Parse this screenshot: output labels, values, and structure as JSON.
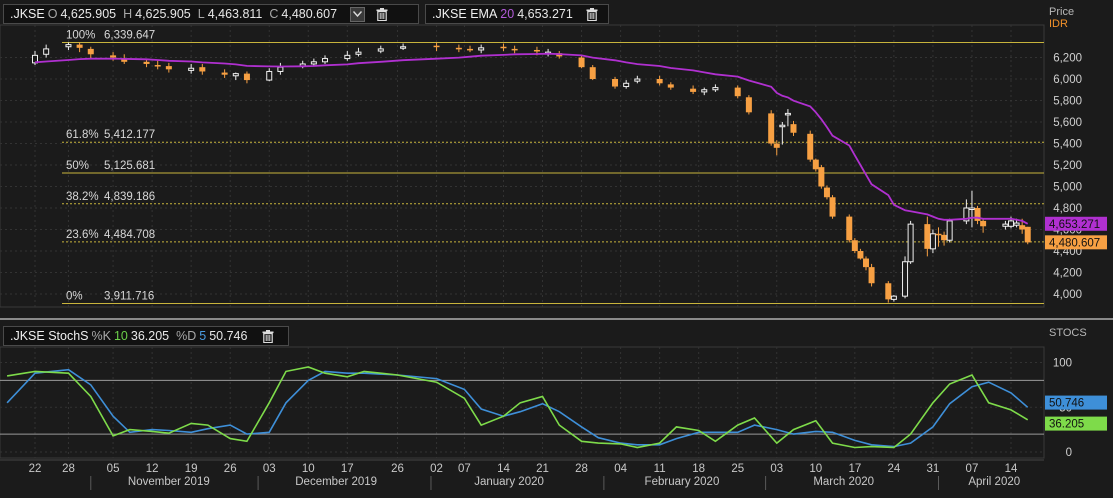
{
  "price_header": {
    "ticker": ".JKSE",
    "open_label": "O",
    "open": "4,625.905",
    "high_label": "H",
    "high": "4,625.905",
    "low_label": "L",
    "low": "4,463.811",
    "close_label": "C",
    "close": "4,480.607"
  },
  "ema_header": {
    "name": ".JKSE EMA",
    "period": "20",
    "value": "4,653.271"
  },
  "stoch_header": {
    "name": ".JKSE StochS",
    "k_label": "%K",
    "k_period": "10",
    "k_value": "36.205",
    "d_label": "%D",
    "d_period": "5",
    "d_value": "50.746"
  },
  "price_scale": {
    "title": "Price",
    "currency": "IDR",
    "ticks": [
      "6,200",
      "6,000",
      "5,800",
      "5,600",
      "5,400",
      "5,200",
      "5,000",
      "4,800",
      "4,600",
      "4,400",
      "4,200",
      "4,000"
    ]
  },
  "stoch_scale": {
    "title": "STOCS",
    "ticks": [
      "100",
      "50",
      "0"
    ]
  },
  "badges": {
    "ema": "4,653.271",
    "close": "4,480.607",
    "d": "50.746",
    "k": "36.205"
  },
  "colors": {
    "up": "#f0f0f0",
    "down": "#f7a043",
    "ema": "#b030d0",
    "k_line": "#7edb4a",
    "d_line": "#3e8fd8",
    "fib": "#c8b43c",
    "background": "#1b1b1b"
  },
  "fib_levels": [
    {
      "pct": "100%",
      "value": "6,339.647",
      "price": 6339.647,
      "style": "solid"
    },
    {
      "pct": "61.8%",
      "value": "5,412.177",
      "price": 5412.177,
      "style": "dashed"
    },
    {
      "pct": "50%",
      "value": "5,125.681",
      "price": 5125.681,
      "style": "solid"
    },
    {
      "pct": "38.2%",
      "value": "4,839.186",
      "price": 4839.186,
      "style": "dashed"
    },
    {
      "pct": "23.6%",
      "value": "4,484.708",
      "price": 4484.708,
      "style": "dashed"
    },
    {
      "pct": "0%",
      "value": "3,911.716",
      "price": 3911.716,
      "style": "solid"
    }
  ],
  "x_axis": {
    "day_ticks": [
      "22",
      "28",
      "05",
      "12",
      "19",
      "26",
      "03",
      "10",
      "17",
      "26",
      "02",
      "07",
      "14",
      "21",
      "28",
      "04",
      "11",
      "18",
      "25",
      "03",
      "10",
      "17",
      "24",
      "31",
      "07",
      "14"
    ],
    "months": [
      "November 2019",
      "December 2019",
      "January 2020",
      "February 2020",
      "March 2020",
      "April 2020"
    ]
  },
  "chart_data": [
    {
      "type": "candlestick",
      "title": "",
      "ylabel": "Price",
      "ylim": [
        3850,
        6450
      ],
      "x": [
        "2019-10-22",
        "2019-10-24",
        "2019-10-28",
        "2019-10-30",
        "2019-11-01",
        "2019-11-05",
        "2019-11-07",
        "2019-11-11",
        "2019-11-13",
        "2019-11-15",
        "2019-11-19",
        "2019-11-21",
        "2019-11-25",
        "2019-11-27",
        "2019-11-29",
        "2019-12-03",
        "2019-12-05",
        "2019-12-09",
        "2019-12-11",
        "2019-12-13",
        "2019-12-17",
        "2019-12-19",
        "2019-12-23",
        "2019-12-27",
        "2020-01-02",
        "2020-01-06",
        "2020-01-08",
        "2020-01-10",
        "2020-01-14",
        "2020-01-16",
        "2020-01-20",
        "2020-01-22",
        "2020-01-24",
        "2020-01-28",
        "2020-01-30",
        "2020-02-03",
        "2020-02-05",
        "2020-02-07",
        "2020-02-11",
        "2020-02-13",
        "2020-02-17",
        "2020-02-19",
        "2020-02-21",
        "2020-02-25",
        "2020-02-27",
        "2020-03-02",
        "2020-03-03",
        "2020-03-04",
        "2020-03-05",
        "2020-03-06",
        "2020-03-09",
        "2020-03-10",
        "2020-03-11",
        "2020-03-12",
        "2020-03-13",
        "2020-03-16",
        "2020-03-17",
        "2020-03-18",
        "2020-03-19",
        "2020-03-20",
        "2020-03-23",
        "2020-03-24",
        "2020-03-26",
        "2020-03-27",
        "2020-03-30",
        "2020-03-31",
        "2020-04-01",
        "2020-04-02",
        "2020-04-03",
        "2020-04-06",
        "2020-04-07",
        "2020-04-08",
        "2020-04-09",
        "2020-04-13",
        "2020-04-14",
        "2020-04-15",
        "2020-04-16",
        "2020-04-17"
      ],
      "open": [
        6150,
        6230,
        6300,
        6320,
        6280,
        6220,
        6190,
        6160,
        6130,
        6120,
        6080,
        6110,
        6060,
        6030,
        6050,
        5990,
        6070,
        6120,
        6140,
        6160,
        6190,
        6230,
        6260,
        6290,
        6310,
        6290,
        6280,
        6270,
        6300,
        6280,
        6270,
        6250,
        6240,
        6200,
        6110,
        6000,
        5930,
        5980,
        6000,
        5950,
        5910,
        5880,
        5900,
        5920,
        5830,
        5680,
        5400,
        5560,
        5680,
        5580,
        5490,
        5250,
        5180,
        4990,
        4900,
        4720,
        4500,
        4400,
        4330,
        4250,
        4100,
        3950,
        3980,
        4300,
        4650,
        4420,
        4560,
        4550,
        4500,
        4680,
        4800,
        4800,
        4680,
        4630,
        4630,
        4640,
        4640,
        4625
      ],
      "high": [
        6260,
        6320,
        6340,
        6340,
        6300,
        6250,
        6230,
        6190,
        6170,
        6150,
        6140,
        6140,
        6090,
        6060,
        6070,
        6100,
        6150,
        6170,
        6190,
        6220,
        6260,
        6290,
        6310,
        6330,
        6340,
        6320,
        6310,
        6320,
        6330,
        6310,
        6300,
        6280,
        6260,
        6220,
        6130,
        6020,
        5990,
        6030,
        6030,
        5970,
        5940,
        5920,
        5950,
        5940,
        5850,
        5710,
        5430,
        5600,
        5720,
        5610,
        5520,
        5260,
        5200,
        5010,
        4920,
        4740,
        4520,
        4420,
        4350,
        4280,
        4120,
        3990,
        4350,
        4680,
        4720,
        4600,
        4620,
        4580,
        4700,
        4880,
        4960,
        4820,
        4700,
        4680,
        4720,
        4700,
        4700,
        4625
      ],
      "low": [
        6130,
        6200,
        6270,
        6250,
        6190,
        6170,
        6140,
        6110,
        6090,
        6060,
        6050,
        6040,
        6010,
        5990,
        5960,
        5980,
        6040,
        6100,
        6120,
        6140,
        6170,
        6210,
        6240,
        6270,
        6260,
        6250,
        6250,
        6240,
        6260,
        6240,
        6220,
        6210,
        6190,
        6100,
        5990,
        5910,
        5910,
        5960,
        5940,
        5900,
        5860,
        5850,
        5880,
        5820,
        5670,
        5380,
        5290,
        5390,
        5560,
        5470,
        5230,
        5140,
        4980,
        4880,
        4700,
        4480,
        4380,
        4320,
        4220,
        4070,
        3920,
        3930,
        3960,
        4280,
        4350,
        4380,
        4440,
        4450,
        4480,
        4650,
        4620,
        4650,
        4570,
        4600,
        4610,
        4620,
        4560,
        4463
      ],
      "close": [
        6220,
        6280,
        6320,
        6290,
        6230,
        6200,
        6160,
        6140,
        6120,
        6090,
        6100,
        6070,
        6040,
        6050,
        5990,
        6070,
        6110,
        6140,
        6160,
        6190,
        6220,
        6250,
        6280,
        6300,
        6300,
        6280,
        6270,
        6290,
        6290,
        6270,
        6260,
        6250,
        6210,
        6110,
        6000,
        5930,
        5960,
        6000,
        5960,
        5920,
        5880,
        5900,
        5920,
        5840,
        5690,
        5400,
        5360,
        5570,
        5680,
        5500,
        5250,
        5160,
        5000,
        4900,
        4720,
        4500,
        4400,
        4330,
        4250,
        4100,
        3950,
        3980,
        4300,
        4650,
        4420,
        4560,
        4550,
        4500,
        4680,
        4800,
        4800,
        4680,
        4630,
        4650,
        4680,
        4660,
        4600,
        4480
      ],
      "series": [
        {
          "name": ".JKSE EMA 20",
          "values": [
            6155,
            6163,
            6177,
            6185,
            6189,
            6190,
            6187,
            6183,
            6177,
            6169,
            6163,
            6154,
            6144,
            6136,
            6122,
            6117,
            6116,
            6118,
            6121,
            6127,
            6136,
            6147,
            6160,
            6175,
            6189,
            6199,
            6207,
            6217,
            6224,
            6230,
            6233,
            6235,
            6232,
            6220,
            6199,
            6174,
            6154,
            6139,
            6121,
            6102,
            6080,
            6061,
            6044,
            6022,
            5986,
            5927,
            5871,
            5844,
            5829,
            5798,
            5745,
            5690,
            5625,
            5552,
            5473,
            5381,
            5290,
            5200,
            5110,
            5020,
            4920,
            4830,
            4780,
            4770,
            4740,
            4720,
            4700,
            4690,
            4690,
            4700,
            4710,
            4710,
            4700,
            4700,
            4700,
            4690,
            4680,
            4653
          ]
        }
      ]
    },
    {
      "type": "line",
      "title": "",
      "ylabel": "STOCS",
      "ylim": [
        0,
        100
      ],
      "x": [
        "2019-10-17",
        "2019-10-22",
        "2019-10-28",
        "2019-11-01",
        "2019-11-05",
        "2019-11-08",
        "2019-11-12",
        "2019-11-15",
        "2019-11-19",
        "2019-11-22",
        "2019-11-26",
        "2019-11-29",
        "2019-12-03",
        "2019-12-06",
        "2019-12-10",
        "2019-12-13",
        "2019-12-17",
        "2019-12-20",
        "2019-12-26",
        "2020-01-02",
        "2020-01-07",
        "2020-01-10",
        "2020-01-14",
        "2020-01-17",
        "2020-01-21",
        "2020-01-24",
        "2020-01-28",
        "2020-01-31",
        "2020-02-04",
        "2020-02-07",
        "2020-02-11",
        "2020-02-14",
        "2020-02-18",
        "2020-02-21",
        "2020-02-25",
        "2020-02-28",
        "2020-03-03",
        "2020-03-06",
        "2020-03-10",
        "2020-03-13",
        "2020-03-17",
        "2020-03-20",
        "2020-03-24",
        "2020-03-27",
        "2020-03-31",
        "2020-04-03",
        "2020-04-07",
        "2020-04-10",
        "2020-04-14",
        "2020-04-17"
      ],
      "series": [
        {
          "name": "%K 10",
          "values": [
            85,
            90,
            88,
            62,
            18,
            25,
            23,
            21,
            32,
            30,
            15,
            12,
            55,
            90,
            95,
            88,
            84,
            90,
            86,
            78,
            60,
            30,
            40,
            55,
            62,
            30,
            12,
            10,
            9,
            5,
            10,
            28,
            24,
            12,
            30,
            38,
            10,
            25,
            35,
            10,
            5,
            6,
            5,
            20,
            55,
            76,
            86,
            55,
            47,
            36
          ]
        },
        {
          "name": "%D 5",
          "values": [
            55,
            88,
            92,
            75,
            40,
            22,
            25,
            24,
            22,
            26,
            30,
            20,
            22,
            55,
            80,
            90,
            88,
            88,
            86,
            82,
            70,
            48,
            40,
            45,
            54,
            45,
            28,
            16,
            10,
            8,
            8,
            15,
            22,
            22,
            22,
            30,
            25,
            20,
            23,
            22,
            13,
            8,
            6,
            10,
            28,
            54,
            73,
            78,
            66,
            50
          ]
        }
      ]
    }
  ]
}
